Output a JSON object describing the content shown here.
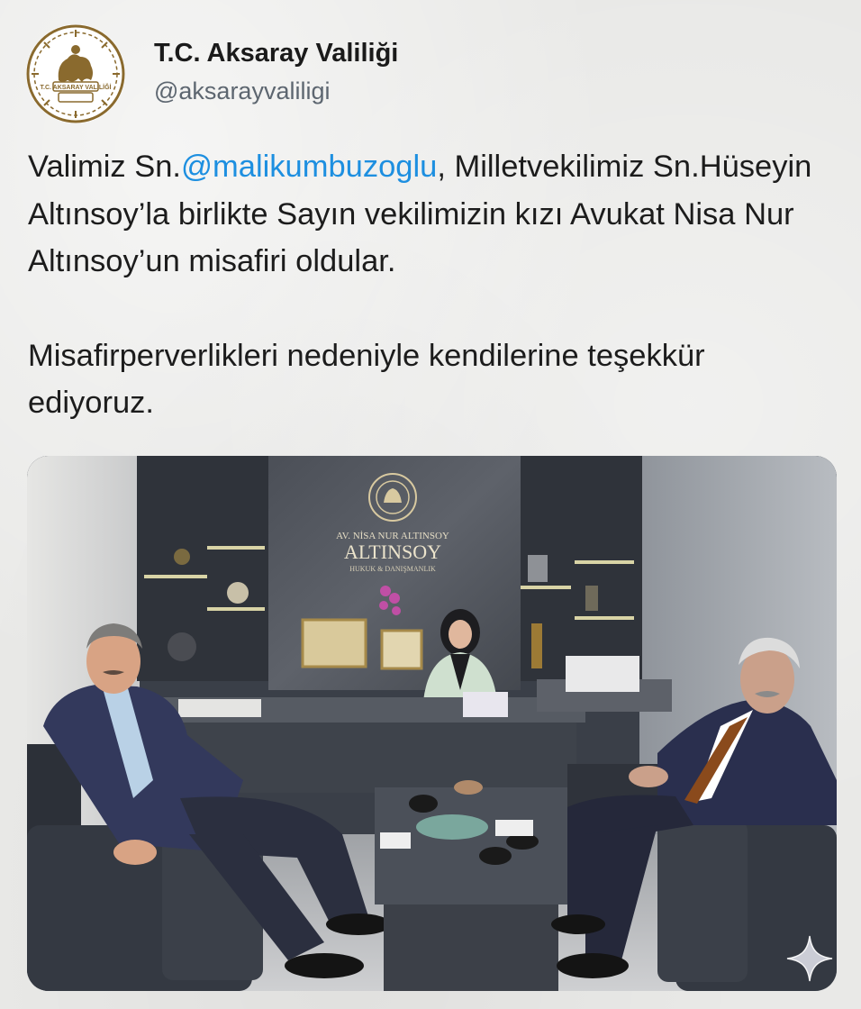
{
  "tweet": {
    "author": {
      "display_name": "T.C. Aksaray Valiliği",
      "handle": "@aksarayvaliligi",
      "avatar": {
        "icon": "aksaray-governorship-seal",
        "seal_text": "T.C. AKSARAY VALİLİĞİ"
      }
    },
    "text": {
      "paragraph1_prefix": "Valimiz Sn.",
      "mention": "@malikumbuzoglu",
      "paragraph1_suffix": ", Milletvekilimiz Sn.Hüseyin Altınsoy’la birlikte Sayın vekilimizin kızı Avukat Nisa Nur Altınsoy’un misafiri oldular.",
      "paragraph2": "Misafirperverlikleri nedeniyle kendilerine teşekkür ediyoruz."
    },
    "photo": {
      "sign_small": "AV. NİSA NUR ALTINSOY",
      "sign_large": "ALTINSOY",
      "sign_sub": "HUKUK & DANIŞMANLIK"
    },
    "overlay_icon": "sparkle-icon"
  },
  "colors": {
    "background": "#e9e9e7",
    "mention": "#1d8fe0",
    "handle": "#5d6670",
    "seal": "#8a6a2e"
  }
}
